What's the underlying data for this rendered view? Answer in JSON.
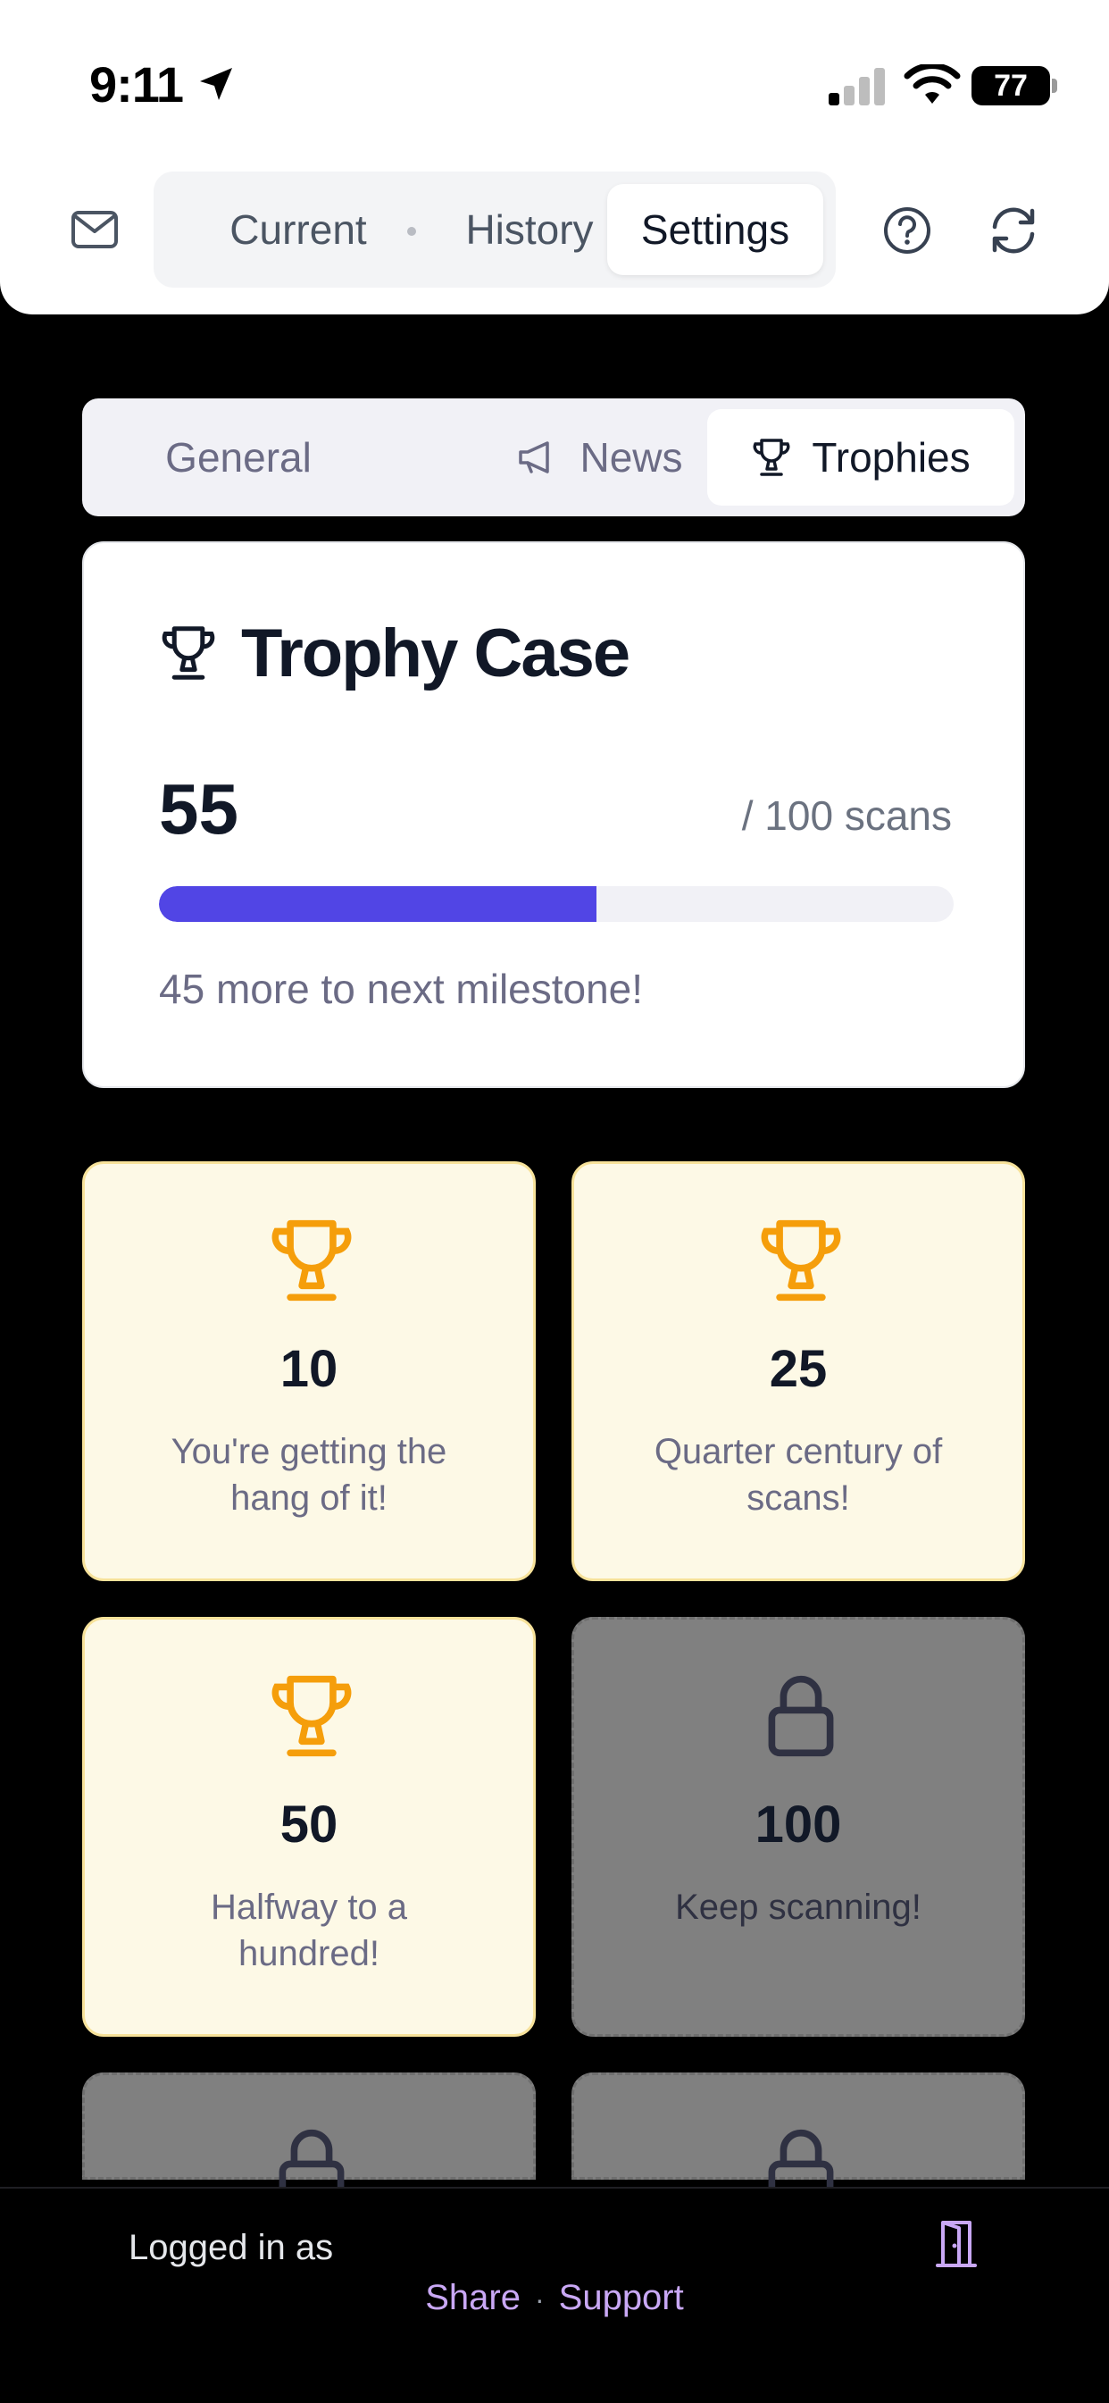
{
  "status_bar": {
    "time": "9:11",
    "battery": "77"
  },
  "header": {
    "tabs": [
      {
        "label": "Current"
      },
      {
        "label": "History"
      },
      {
        "label": "Settings"
      }
    ],
    "active_tab": "Settings",
    "icons": [
      "mail-icon",
      "help-icon",
      "refresh-icon"
    ]
  },
  "settings_tabs": {
    "items": [
      {
        "label": "General",
        "icon": ""
      },
      {
        "label": "News",
        "icon": "megaphone-icon"
      },
      {
        "label": "Trophies",
        "icon": "trophy-icon"
      }
    ],
    "active": "Trophies"
  },
  "trophy_case": {
    "title": "Trophy Case",
    "count": "55",
    "goal": "/ 100 scans",
    "progress_fraction": 0.55,
    "remaining_text": "45 more to next milestone!"
  },
  "trophies": [
    {
      "milestone": "10",
      "text": "You're getting the hang of it!",
      "unlocked": true
    },
    {
      "milestone": "25",
      "text": "Quarter century of scans!",
      "unlocked": true
    },
    {
      "milestone": "50",
      "text": "Halfway to a hundred!",
      "unlocked": true
    },
    {
      "milestone": "100",
      "text": "Keep scanning!",
      "unlocked": false
    }
  ],
  "footer": {
    "logged_in": "Logged in as",
    "share": "Share",
    "separator": "·",
    "support": "Support"
  },
  "colors": {
    "accent": "#5145e5",
    "trophy_gold": "#f59e0b",
    "unlocked_bg": "#fdf9e6",
    "locked_bg": "#808080",
    "link": "#c9a8f5"
  }
}
